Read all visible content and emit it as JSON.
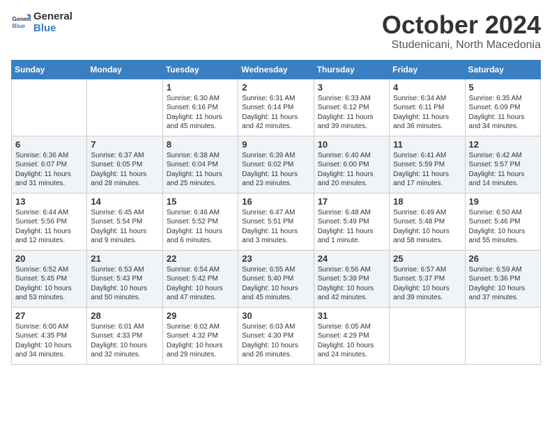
{
  "header": {
    "logo_general": "General",
    "logo_blue": "Blue",
    "month": "October 2024",
    "location": "Studenicani, North Macedonia"
  },
  "weekdays": [
    "Sunday",
    "Monday",
    "Tuesday",
    "Wednesday",
    "Thursday",
    "Friday",
    "Saturday"
  ],
  "weeks": [
    [
      {
        "day": "",
        "sunrise": "",
        "sunset": "",
        "daylight": ""
      },
      {
        "day": "",
        "sunrise": "",
        "sunset": "",
        "daylight": ""
      },
      {
        "day": "1",
        "sunrise": "Sunrise: 6:30 AM",
        "sunset": "Sunset: 6:16 PM",
        "daylight": "Daylight: 11 hours and 45 minutes."
      },
      {
        "day": "2",
        "sunrise": "Sunrise: 6:31 AM",
        "sunset": "Sunset: 6:14 PM",
        "daylight": "Daylight: 11 hours and 42 minutes."
      },
      {
        "day": "3",
        "sunrise": "Sunrise: 6:33 AM",
        "sunset": "Sunset: 6:12 PM",
        "daylight": "Daylight: 11 hours and 39 minutes."
      },
      {
        "day": "4",
        "sunrise": "Sunrise: 6:34 AM",
        "sunset": "Sunset: 6:11 PM",
        "daylight": "Daylight: 11 hours and 36 minutes."
      },
      {
        "day": "5",
        "sunrise": "Sunrise: 6:35 AM",
        "sunset": "Sunset: 6:09 PM",
        "daylight": "Daylight: 11 hours and 34 minutes."
      }
    ],
    [
      {
        "day": "6",
        "sunrise": "Sunrise: 6:36 AM",
        "sunset": "Sunset: 6:07 PM",
        "daylight": "Daylight: 11 hours and 31 minutes."
      },
      {
        "day": "7",
        "sunrise": "Sunrise: 6:37 AM",
        "sunset": "Sunset: 6:05 PM",
        "daylight": "Daylight: 11 hours and 28 minutes."
      },
      {
        "day": "8",
        "sunrise": "Sunrise: 6:38 AM",
        "sunset": "Sunset: 6:04 PM",
        "daylight": "Daylight: 11 hours and 25 minutes."
      },
      {
        "day": "9",
        "sunrise": "Sunrise: 6:39 AM",
        "sunset": "Sunset: 6:02 PM",
        "daylight": "Daylight: 11 hours and 23 minutes."
      },
      {
        "day": "10",
        "sunrise": "Sunrise: 6:40 AM",
        "sunset": "Sunset: 6:00 PM",
        "daylight": "Daylight: 11 hours and 20 minutes."
      },
      {
        "day": "11",
        "sunrise": "Sunrise: 6:41 AM",
        "sunset": "Sunset: 5:59 PM",
        "daylight": "Daylight: 11 hours and 17 minutes."
      },
      {
        "day": "12",
        "sunrise": "Sunrise: 6:42 AM",
        "sunset": "Sunset: 5:57 PM",
        "daylight": "Daylight: 11 hours and 14 minutes."
      }
    ],
    [
      {
        "day": "13",
        "sunrise": "Sunrise: 6:44 AM",
        "sunset": "Sunset: 5:56 PM",
        "daylight": "Daylight: 11 hours and 12 minutes."
      },
      {
        "day": "14",
        "sunrise": "Sunrise: 6:45 AM",
        "sunset": "Sunset: 5:54 PM",
        "daylight": "Daylight: 11 hours and 9 minutes."
      },
      {
        "day": "15",
        "sunrise": "Sunrise: 6:46 AM",
        "sunset": "Sunset: 5:52 PM",
        "daylight": "Daylight: 11 hours and 6 minutes."
      },
      {
        "day": "16",
        "sunrise": "Sunrise: 6:47 AM",
        "sunset": "Sunset: 5:51 PM",
        "daylight": "Daylight: 11 hours and 3 minutes."
      },
      {
        "day": "17",
        "sunrise": "Sunrise: 6:48 AM",
        "sunset": "Sunset: 5:49 PM",
        "daylight": "Daylight: 11 hours and 1 minute."
      },
      {
        "day": "18",
        "sunrise": "Sunrise: 6:49 AM",
        "sunset": "Sunset: 5:48 PM",
        "daylight": "Daylight: 10 hours and 58 minutes."
      },
      {
        "day": "19",
        "sunrise": "Sunrise: 6:50 AM",
        "sunset": "Sunset: 5:46 PM",
        "daylight": "Daylight: 10 hours and 55 minutes."
      }
    ],
    [
      {
        "day": "20",
        "sunrise": "Sunrise: 6:52 AM",
        "sunset": "Sunset: 5:45 PM",
        "daylight": "Daylight: 10 hours and 53 minutes."
      },
      {
        "day": "21",
        "sunrise": "Sunrise: 6:53 AM",
        "sunset": "Sunset: 5:43 PM",
        "daylight": "Daylight: 10 hours and 50 minutes."
      },
      {
        "day": "22",
        "sunrise": "Sunrise: 6:54 AM",
        "sunset": "Sunset: 5:42 PM",
        "daylight": "Daylight: 10 hours and 47 minutes."
      },
      {
        "day": "23",
        "sunrise": "Sunrise: 6:55 AM",
        "sunset": "Sunset: 5:40 PM",
        "daylight": "Daylight: 10 hours and 45 minutes."
      },
      {
        "day": "24",
        "sunrise": "Sunrise: 6:56 AM",
        "sunset": "Sunset: 5:39 PM",
        "daylight": "Daylight: 10 hours and 42 minutes."
      },
      {
        "day": "25",
        "sunrise": "Sunrise: 6:57 AM",
        "sunset": "Sunset: 5:37 PM",
        "daylight": "Daylight: 10 hours and 39 minutes."
      },
      {
        "day": "26",
        "sunrise": "Sunrise: 6:59 AM",
        "sunset": "Sunset: 5:36 PM",
        "daylight": "Daylight: 10 hours and 37 minutes."
      }
    ],
    [
      {
        "day": "27",
        "sunrise": "Sunrise: 6:00 AM",
        "sunset": "Sunset: 4:35 PM",
        "daylight": "Daylight: 10 hours and 34 minutes."
      },
      {
        "day": "28",
        "sunrise": "Sunrise: 6:01 AM",
        "sunset": "Sunset: 4:33 PM",
        "daylight": "Daylight: 10 hours and 32 minutes."
      },
      {
        "day": "29",
        "sunrise": "Sunrise: 6:02 AM",
        "sunset": "Sunset: 4:32 PM",
        "daylight": "Daylight: 10 hours and 29 minutes."
      },
      {
        "day": "30",
        "sunrise": "Sunrise: 6:03 AM",
        "sunset": "Sunset: 4:30 PM",
        "daylight": "Daylight: 10 hours and 26 minutes."
      },
      {
        "day": "31",
        "sunrise": "Sunrise: 6:05 AM",
        "sunset": "Sunset: 4:29 PM",
        "daylight": "Daylight: 10 hours and 24 minutes."
      },
      {
        "day": "",
        "sunrise": "",
        "sunset": "",
        "daylight": ""
      },
      {
        "day": "",
        "sunrise": "",
        "sunset": "",
        "daylight": ""
      }
    ]
  ]
}
